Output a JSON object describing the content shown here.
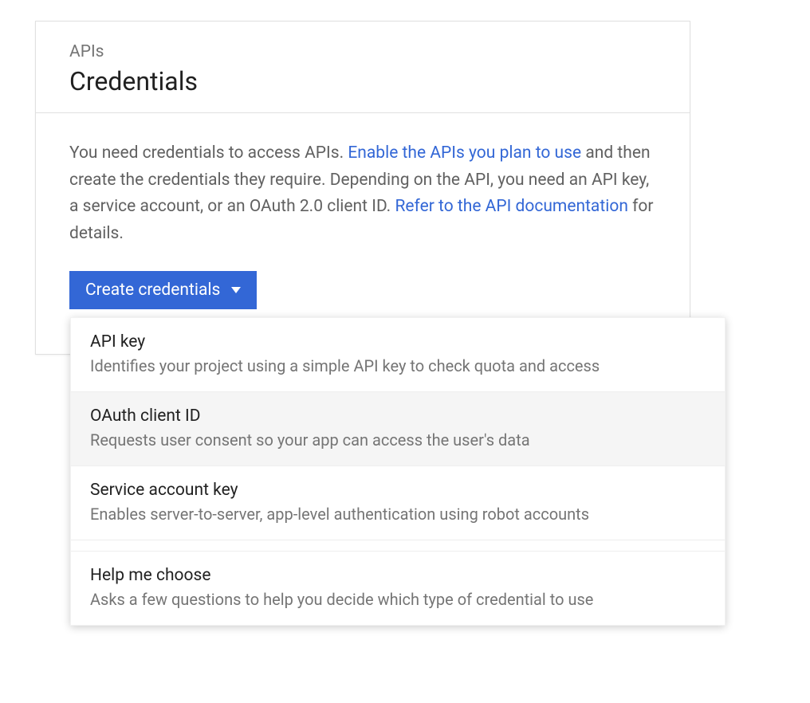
{
  "header": {
    "section": "APIs",
    "title": "Credentials"
  },
  "intro": {
    "t1": "You need credentials to access APIs. ",
    "link1": "Enable the APIs you plan to use",
    "t2": " and then create the credentials they require. Depending on the API, you need an API key, a service account, or an OAuth 2.0 client ID. ",
    "link2": "Refer to the API documentation",
    "t3": " for details."
  },
  "button": {
    "label": "Create credentials"
  },
  "menu": {
    "items": [
      {
        "title": "API key",
        "desc": "Identifies your project using a simple API key to check quota and access"
      },
      {
        "title": "OAuth client ID",
        "desc": "Requests user consent so your app can access the user's data"
      },
      {
        "title": "Service account key",
        "desc": "Enables server-to-server, app-level authentication using robot accounts"
      },
      {
        "title": "Help me choose",
        "desc": "Asks a few questions to help you decide which type of credential to use"
      }
    ]
  }
}
